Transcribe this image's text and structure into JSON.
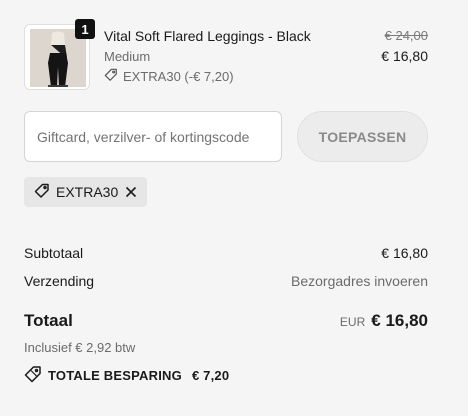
{
  "product": {
    "quantity": "1",
    "name": "Vital Soft Flared Leggings - Black",
    "variant": "Medium",
    "discount": "EXTRA30 (-€ 7,20)",
    "old_price": "€ 24,00",
    "price": "€ 16,80"
  },
  "code_form": {
    "placeholder": "Giftcard, verzilver- of kortingscode",
    "apply_label": "TOEPASSEN"
  },
  "applied_code": {
    "code": "EXTRA30",
    "icon": "tag-icon",
    "remove_icon": "close-icon"
  },
  "summary": {
    "subtotal_label": "Subtotaal",
    "subtotal_value": "€ 16,80",
    "shipping_label": "Verzending",
    "shipping_value": "Bezorgadres invoeren",
    "total_label": "Totaal",
    "currency": "EUR",
    "total_value": "€ 16,80",
    "vat_note": "Inclusief € 2,92 btw",
    "savings_label": "TOTALE BESPARING",
    "savings_value": "€ 7,20"
  },
  "colors": {
    "background": "#f5f5f5",
    "badge": "#111111",
    "button_bg": "#ececec",
    "chip_bg": "#e6e6e6"
  }
}
